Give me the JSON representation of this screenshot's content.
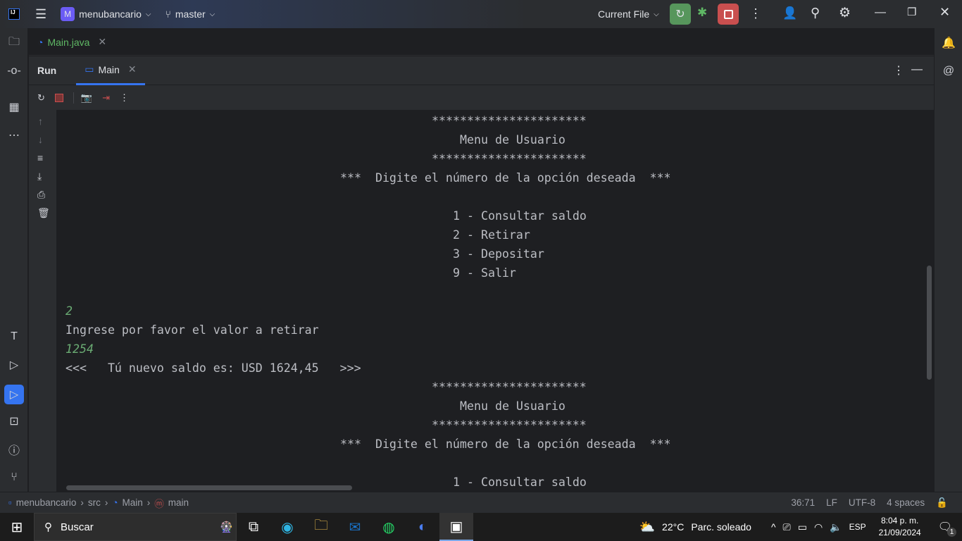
{
  "titlebar": {
    "project": "menubancario",
    "project_initial": "M",
    "branch": "master",
    "run_config": "Current File"
  },
  "editor": {
    "tab": "Main.java"
  },
  "run": {
    "title": "Run",
    "tab": "Main"
  },
  "console": [
    {
      "text": "**********************",
      "col": 53,
      "input": false
    },
    {
      "text": "Menu de Usuario",
      "col": 57,
      "input": false
    },
    {
      "text": "**********************",
      "col": 53,
      "input": false
    },
    {
      "text": "***  Digite el número de la opción deseada  ***",
      "col": 40,
      "input": false
    },
    {
      "text": "",
      "col": 0,
      "input": false
    },
    {
      "text": "1 - Consultar saldo",
      "col": 56,
      "input": false
    },
    {
      "text": "2 - Retirar",
      "col": 56,
      "input": false
    },
    {
      "text": "3 - Depositar",
      "col": 56,
      "input": false
    },
    {
      "text": "9 - Salir",
      "col": 56,
      "input": false
    },
    {
      "text": "",
      "col": 0,
      "input": false
    },
    {
      "text": "2",
      "col": 1,
      "input": true
    },
    {
      "text": "Ingrese por favor el valor a retirar",
      "col": 1,
      "input": false
    },
    {
      "text": "1254",
      "col": 1,
      "input": true
    },
    {
      "text": "<<<   Tú nuevo saldo es: USD 1624,45   >>>",
      "col": 1,
      "input": false
    },
    {
      "text": "**********************",
      "col": 53,
      "input": false
    },
    {
      "text": "Menu de Usuario",
      "col": 57,
      "input": false
    },
    {
      "text": "**********************",
      "col": 53,
      "input": false
    },
    {
      "text": "***  Digite el número de la opción deseada  ***",
      "col": 40,
      "input": false
    },
    {
      "text": "",
      "col": 0,
      "input": false
    },
    {
      "text": "1 - Consultar saldo",
      "col": 56,
      "input": false
    }
  ],
  "breadcrumb": [
    "menubancario",
    "src",
    "Main",
    "main"
  ],
  "status": {
    "position": "36:71",
    "line_sep": "LF",
    "encoding": "UTF-8",
    "indent": "4 spaces"
  },
  "taskbar": {
    "search": "Buscar",
    "weather_temp": "22°C",
    "weather_text": "Parc. soleado",
    "lang": "ESP",
    "time": "8:04 p. m.",
    "date": "21/09/2024",
    "notifications": "1"
  },
  "colors": {
    "run_green": "#57965c",
    "stop_red": "#c94f4f",
    "accent": "#3574f0",
    "input_text": "#6aab73"
  }
}
